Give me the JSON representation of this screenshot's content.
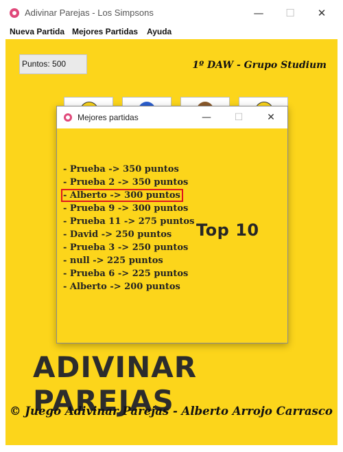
{
  "window": {
    "title": "Adivinar Parejas - Los Simpsons",
    "minimize_glyph": "—",
    "maximize_glyph": "☐",
    "close_glyph": "✕"
  },
  "menu": {
    "items": [
      "Nueva Partida",
      "Mejores Partidas",
      "Ayuda"
    ]
  },
  "main": {
    "score_text": "Puntos: 500",
    "group_label": "1º DAW - Grupo Studium",
    "title": "ADIVINAR PAREJAS",
    "credit": "© Juego Adivinar Parejas - Alberto Arrojo Carrasco"
  },
  "cards": [
    {
      "icon": "homer-icon",
      "color": "#fcd51b"
    },
    {
      "icon": "marge-icon",
      "color": "#2b5fcf"
    },
    {
      "icon": "ned-icon",
      "color": "#8a5a2b"
    },
    {
      "icon": "bart-icon",
      "color": "#fcd51b"
    }
  ],
  "dialog": {
    "title": "Mejores partidas",
    "heading": "Top 10",
    "rankings": [
      "- Prueba ->  350 puntos",
      "- Prueba 2 ->  350 puntos",
      "- Alberto ->  300 puntos",
      "- Prueba 9 ->  300 puntos",
      "- Prueba 11 ->  275 puntos",
      "- David ->  250 puntos",
      "- Prueba 3 ->  250 puntos",
      "- null ->  225 puntos",
      "- Prueba 6 ->  225 puntos",
      "- Alberto ->  200 puntos"
    ],
    "highlighted_index": 2
  },
  "colors": {
    "background": "#fcd51b",
    "highlight_border": "#e0141e",
    "title_text": "#2c2c2c"
  }
}
